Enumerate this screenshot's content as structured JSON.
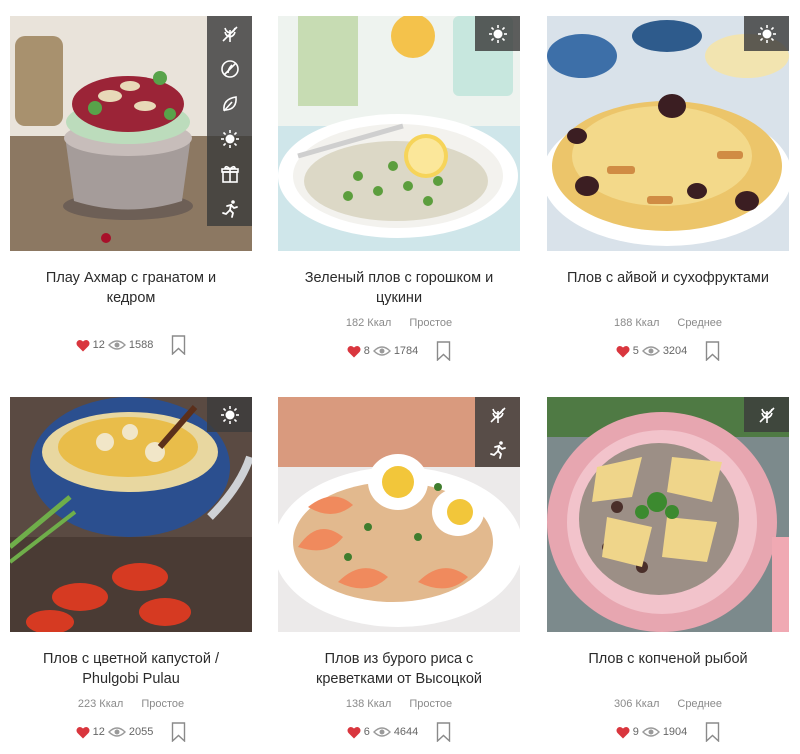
{
  "recipes": [
    {
      "title": "Плау Ахмар с гранатом и кедром",
      "kcal": "",
      "difficulty": "",
      "likes": "12",
      "views": "1588",
      "badges": [
        "no-gluten-icon",
        "no-sugar-icon",
        "vegetarian-icon",
        "sun-icon",
        "gift-icon",
        "runner-icon"
      ]
    },
    {
      "title": "Зеленый плов с горошком и цукини",
      "kcal": "182 Ккал",
      "difficulty": "Простое",
      "likes": "8",
      "views": "1784",
      "badges": [
        "sun-icon"
      ]
    },
    {
      "title": "Плов с айвой и сухофруктами",
      "kcal": "188 Ккал",
      "difficulty": "Среднее",
      "likes": "5",
      "views": "3204",
      "badges": [
        "sun-icon"
      ]
    },
    {
      "title": "Плов с цветной капустой / Phulgobi Pulau",
      "kcal": "223 Ккал",
      "difficulty": "Простое",
      "likes": "12",
      "views": "2055",
      "badges": [
        "sun-icon"
      ]
    },
    {
      "title": "Плов из бурого риса с креветками от Высоцкой",
      "kcal": "138 Ккал",
      "difficulty": "Простое",
      "likes": "6",
      "views": "4644",
      "badges": [
        "no-gluten-icon",
        "runner-icon"
      ]
    },
    {
      "title": "Плов с копченой рыбой",
      "kcal": "306 Ккал",
      "difficulty": "Среднее",
      "likes": "9",
      "views": "1904",
      "badges": [
        "no-gluten-icon"
      ]
    }
  ],
  "colors": {
    "heart": "#d9363e",
    "badge_bg": "#3c3c3c",
    "text": "#2b2b2b",
    "muted": "#8a8a8a"
  }
}
